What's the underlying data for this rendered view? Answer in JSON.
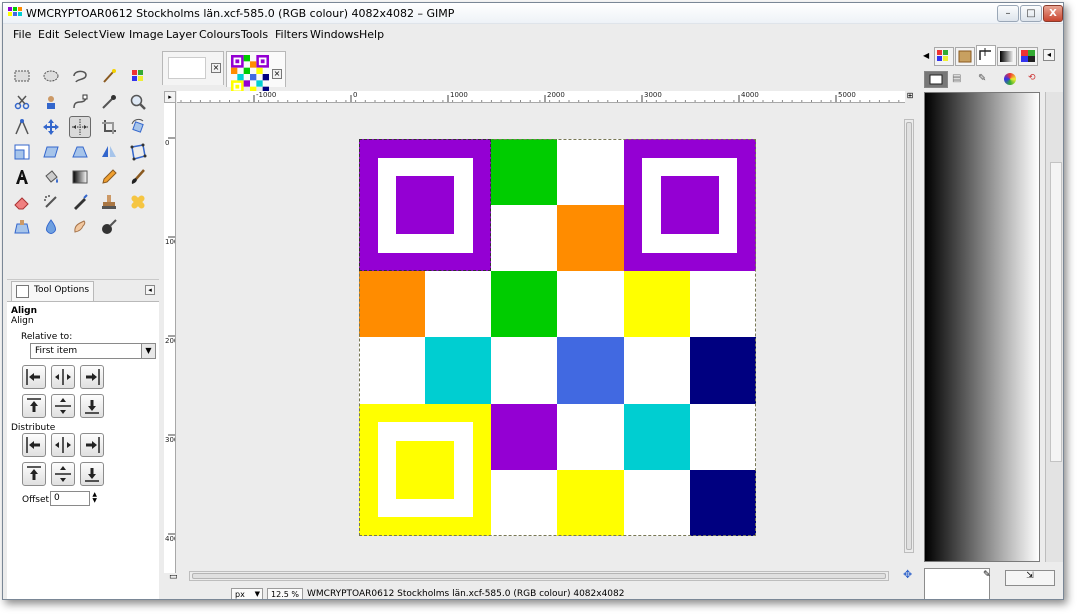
{
  "window": {
    "title": "WMCRYPTOAR0612 Stockholms län.xcf-585.0 (RGB colour) 4082x4082 – GIMP",
    "controls": {
      "minimize": "–",
      "maximize": "□",
      "close": "X"
    }
  },
  "menu": [
    {
      "label": "File"
    },
    {
      "label": "Edit"
    },
    {
      "label": "Select"
    },
    {
      "label": "View"
    },
    {
      "label": "Image"
    },
    {
      "label": "Layer"
    },
    {
      "label": "Colours"
    },
    {
      "label": "Tools"
    },
    {
      "label": "Filters"
    },
    {
      "label": "Windows"
    },
    {
      "label": "Help"
    }
  ],
  "tool_options": {
    "tab_label": "Tool Options",
    "heading": "Align",
    "subheading": "Align",
    "relative_to_label": "Relative to:",
    "relative_to_value": "First item",
    "distribute_label": "Distribute",
    "offset_label": "Offset:",
    "offset_value": "0"
  },
  "ruler": {
    "h_labels": [
      "-1000",
      "0",
      "1000",
      "2000",
      "3000",
      "4000",
      "5000"
    ],
    "v_labels": [
      "0",
      "1000",
      "2000",
      "3000",
      "4000"
    ]
  },
  "statusbar": {
    "unit": "px",
    "zoom": "12.5 %",
    "message": "WMCRYPTOAR0612 Stockholms län.xcf-585.0 (RGB colour) 4082x4082"
  },
  "colors": {
    "purple": "#9400d3",
    "green": "#00cc00",
    "orange": "#ff8c00",
    "yellow": "#ffff00",
    "cyan": "#00ced1",
    "blue": "#4169e1",
    "navy": "#000080",
    "white": "#ffffff"
  },
  "qr_cells": [
    [
      "finder",
      "finder",
      "green",
      "white",
      "finder",
      "finder"
    ],
    [
      "finder",
      "finder",
      "white",
      "orange",
      "finder",
      "finder"
    ],
    [
      "orange",
      "white",
      "green",
      "white",
      "yellow",
      "white"
    ],
    [
      "white",
      "cyan",
      "white",
      "blue",
      "white",
      "navy"
    ],
    [
      "finder",
      "finder",
      "purple",
      "white",
      "cyan",
      "white"
    ],
    [
      "finder",
      "finder",
      "white",
      "yellow",
      "white",
      "navy"
    ]
  ]
}
